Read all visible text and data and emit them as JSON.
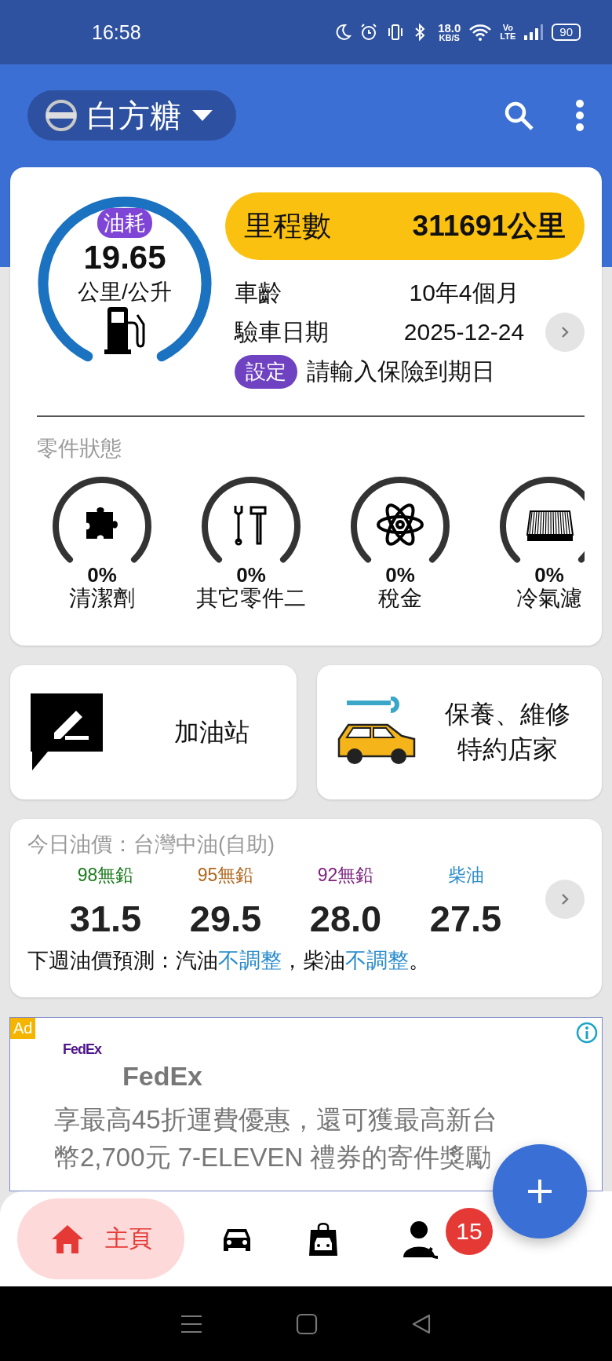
{
  "status_bar": {
    "time": "16:58",
    "net_speed": "18.0",
    "net_unit": "KB/S",
    "volte_top": "Vo",
    "volte_bottom": "LTE",
    "battery": "90"
  },
  "app_bar": {
    "car_name": "白方糖"
  },
  "summary": {
    "consumption_label": "油耗",
    "consumption": "19.65",
    "consumption_unit": "公里/公升",
    "mileage_label": "里程數",
    "mileage": "311691公里",
    "rows": [
      {
        "label": "車齡",
        "value": "10年4個月"
      },
      {
        "label": "驗車日期",
        "value": "2025-12-24"
      }
    ],
    "insurance_button": "設定",
    "insurance_prompt": "請輸入保險到期日"
  },
  "parts": {
    "title": "零件狀態",
    "items": [
      {
        "percent": "0%",
        "name": "清潔劑"
      },
      {
        "percent": "0%",
        "name": "其它零件二"
      },
      {
        "percent": "0%",
        "name": "稅金"
      },
      {
        "percent": "0%",
        "name": "冷氣濾"
      }
    ]
  },
  "shortcuts": [
    {
      "label": "加油站"
    },
    {
      "label": "保養、維修特約店家"
    }
  ],
  "fuel_prices": {
    "title": "今日油價：台灣中油(自助)",
    "grades": [
      {
        "name": "98無鉛",
        "color": "#1b7a1b",
        "price": "31.5"
      },
      {
        "name": "95無鉛",
        "color": "#b0661c",
        "price": "29.5"
      },
      {
        "name": "92無鉛",
        "color": "#7a1f7d",
        "price": "28.0"
      },
      {
        "name": "柴油",
        "color": "#2a8ccc",
        "price": "27.5"
      }
    ],
    "forecast": [
      {
        "text": "下週油價預測：汽油",
        "highlight": false
      },
      {
        "text": "不調整",
        "highlight": true
      },
      {
        "text": "，柴油",
        "highlight": false
      },
      {
        "text": "不調整",
        "highlight": true
      },
      {
        "text": "。",
        "highlight": false
      }
    ]
  },
  "ad": {
    "tag": "Ad",
    "logo": "FedEx",
    "headline": "FedEx",
    "body": "享最高45折運費優惠，還可獲最高新台幣2,700元 7-ELEVEN 禮券的寄件獎勵"
  },
  "bottom_nav": {
    "items": [
      {
        "label": "主頁",
        "selected": true
      },
      {
        "selected": false
      },
      {
        "selected": false
      },
      {
        "selected": false,
        "badge": "15"
      }
    ]
  }
}
